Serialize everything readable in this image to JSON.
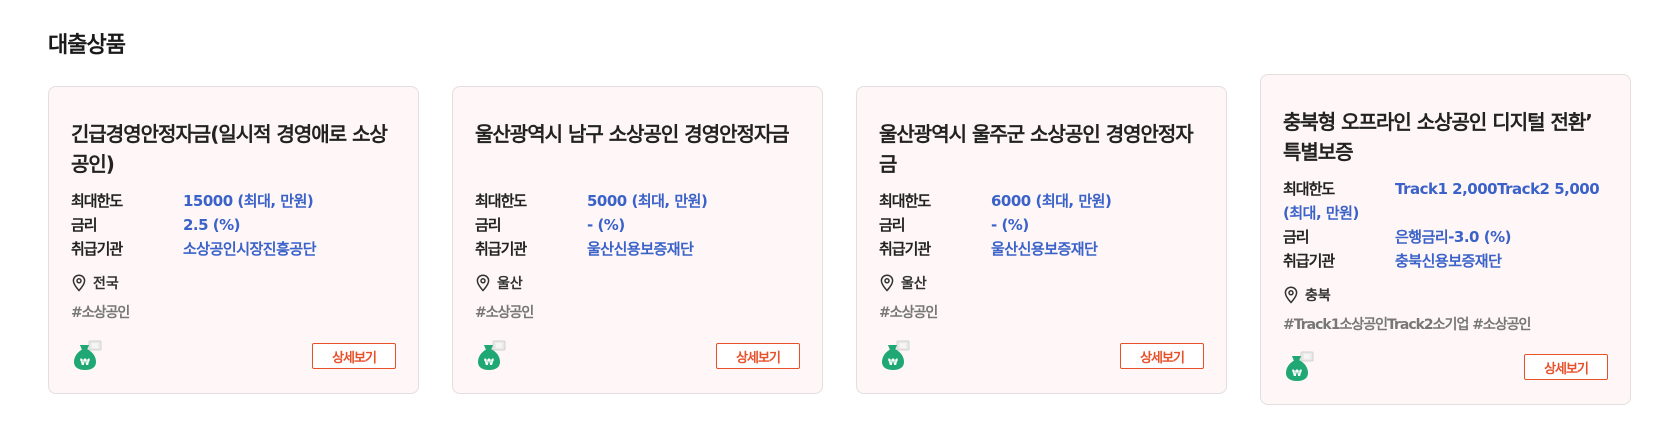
{
  "section": {
    "title": "대출상품"
  },
  "labels": {
    "limit": "최대한도",
    "rate": "금리",
    "agency": "취급기관",
    "detail_button": "상세보기"
  },
  "colors": {
    "card_bg": "#fff7f7",
    "value_text": "#3a62c9",
    "button_accent": "#e8502a",
    "money_bag": "#1fa774"
  },
  "cards": [
    {
      "title": "긴급경영안정자금(일시적 경영애로 소상공인)",
      "limit": "15000 (최대, 만원)",
      "rate": "2.5 (%)",
      "agency": "소상공인시장진흥공단",
      "region": "전국",
      "tags": "#소상공인",
      "icon": "money-bag-icon"
    },
    {
      "title": "울산광역시 남구 소상공인 경영안정자금",
      "limit": "5000 (최대, 만원)",
      "rate": "- (%)",
      "agency": "울산신용보증재단",
      "region": "울산",
      "tags": "#소상공인",
      "icon": "money-bag-icon"
    },
    {
      "title": "울산광역시 울주군 소상공인 경영안정자금",
      "limit": "6000 (최대, 만원)",
      "rate": "- (%)",
      "agency": "울산신용보증재단",
      "region": "울산",
      "tags": "#소상공인",
      "icon": "money-bag-icon"
    },
    {
      "title": "충북형 오프라인 소상공인 디지털 전환’ 특별보증",
      "limit": "Track1 2,000Track2 5,000 (최대, 만원)",
      "rate": "은행금리-3.0 (%)",
      "agency": "충북신용보증재단",
      "region": "충북",
      "tags": "#Track1소상공인Track2소기업 #소상공인",
      "icon": "money-bag-icon"
    }
  ]
}
